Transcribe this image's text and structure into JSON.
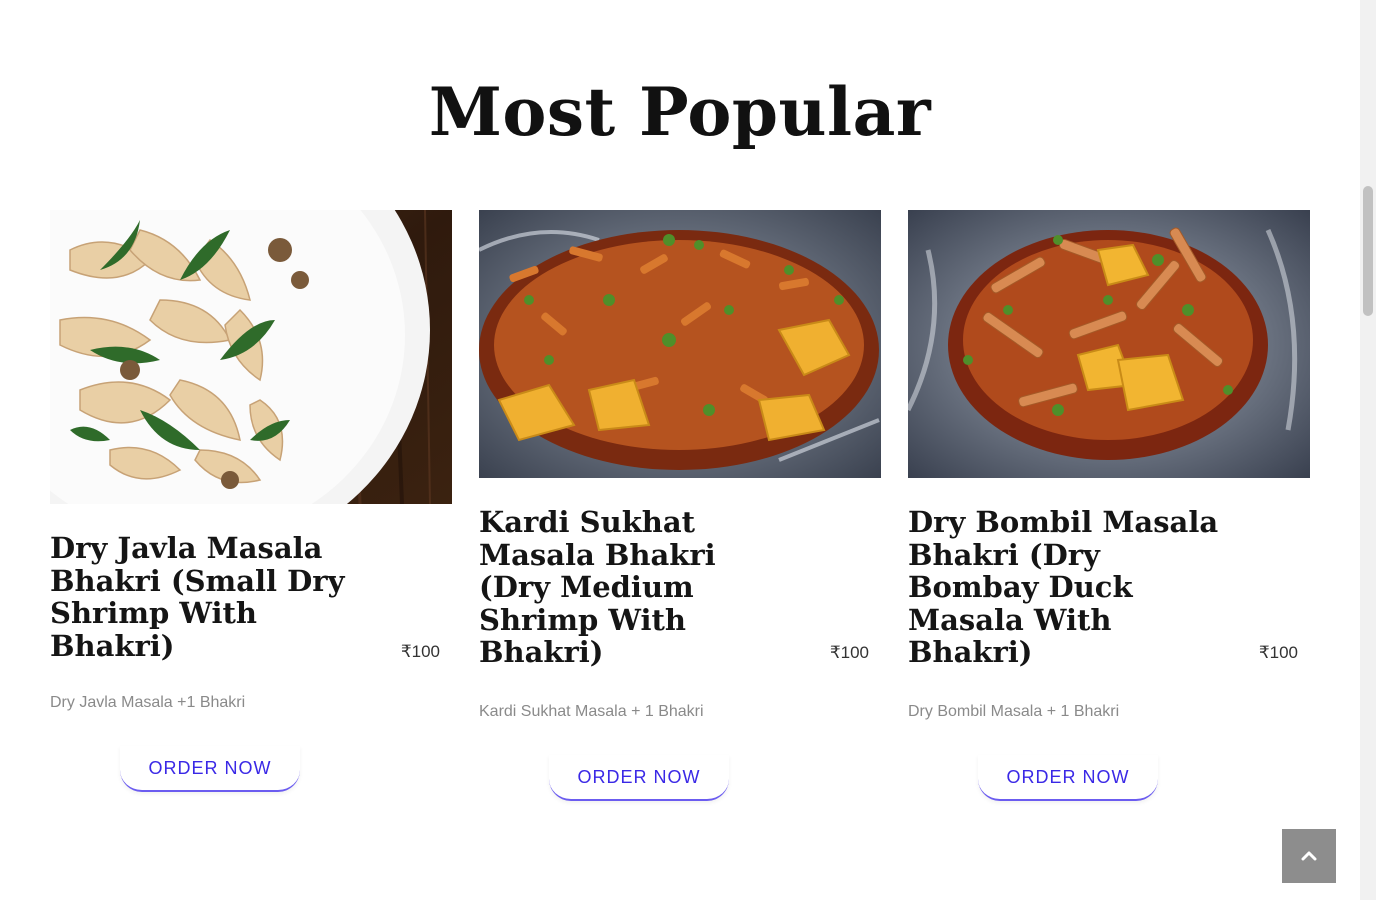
{
  "section": {
    "title": "Most Popular"
  },
  "cards": [
    {
      "title": "Dry Javla Masala Bhakri (Small Dry Shrimp With Bhakri)",
      "price": "₹100",
      "description": "Dry Javla Masala +1 Bhakri",
      "button_label": "ORDER NOW",
      "image": "pasta-with-spinach-photo"
    },
    {
      "title": "Kardi Sukhat Masala Bhakri (Dry Medium Shrimp With Bhakri)",
      "price": "₹100",
      "description": "Kardi Sukhat Masala + 1 Bhakri",
      "button_label": "ORDER NOW",
      "image": "shrimp-potato-curry-photo"
    },
    {
      "title": "Dry Bombil Masala Bhakri (Dry Bombay Duck Masala With Bhakri)",
      "price": "₹100",
      "description": "Dry Bombil Masala + 1 Bhakri",
      "button_label": "ORDER NOW",
      "image": "bombil-potato-curry-photo"
    }
  ],
  "colors": {
    "button_text": "#3a28e6",
    "button_border": "#6b5cf0",
    "back_to_top_bg": "#8d8d8d"
  },
  "icons": {
    "back_to_top": "chevron-up-icon"
  }
}
